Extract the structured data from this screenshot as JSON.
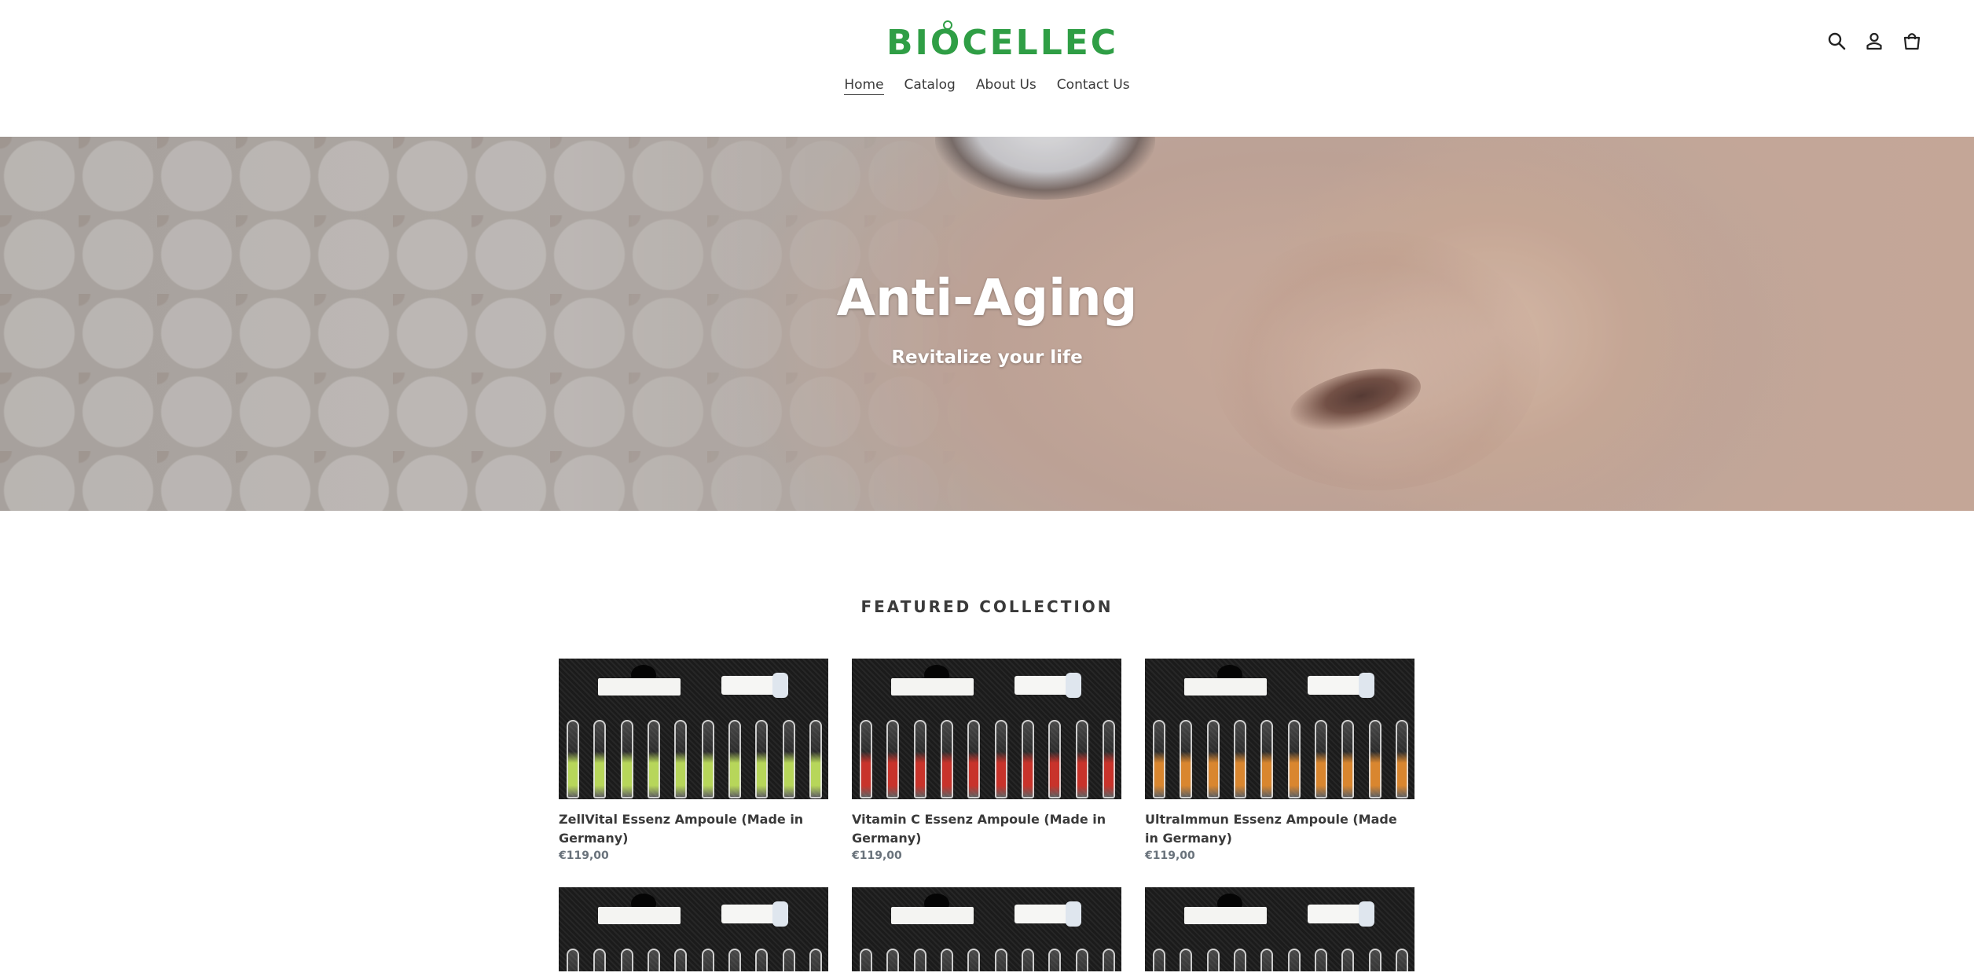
{
  "header": {
    "logo_text": "BIOCELLEC",
    "nav": [
      {
        "label": "Home",
        "active": true
      },
      {
        "label": "Catalog",
        "active": false
      },
      {
        "label": "About Us",
        "active": false
      },
      {
        "label": "Contact Us",
        "active": false
      }
    ],
    "icons": [
      "search-icon",
      "account-icon",
      "cart-icon"
    ],
    "brand_color": "#2f9e45"
  },
  "hero": {
    "title": "Anti-Aging",
    "subtitle": "Revitalize your life"
  },
  "featured": {
    "heading": "FEATURED COLLECTION",
    "products": [
      {
        "title": "ZellVital Essenz Ampoule (Made in Germany)",
        "price": "€119,00",
        "liquid": "#b7d65a"
      },
      {
        "title": "Vitamin C Essenz Ampoule (Made in Germany)",
        "price": "€119,00",
        "liquid": "#c8332b"
      },
      {
        "title": "UltraImmun Essenz Ampoule (Made in Germany)",
        "price": "€119,00",
        "liquid": "#d9862f"
      },
      {
        "title": "",
        "price": "",
        "liquid": "#c9a9a9"
      },
      {
        "title": "",
        "price": "",
        "liquid": "#b8b8c8"
      },
      {
        "title": "",
        "price": "",
        "liquid": "#c89a52"
      }
    ]
  }
}
